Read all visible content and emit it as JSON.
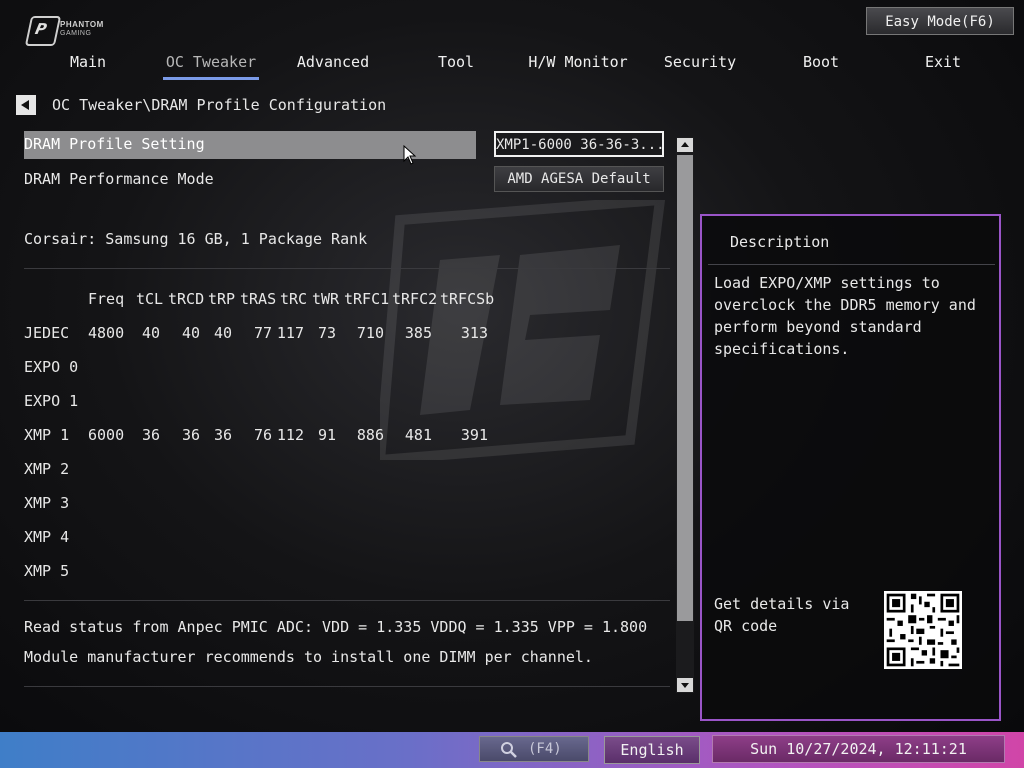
{
  "brand": {
    "logo_line1": "PHANTOM",
    "logo_line2": "GAMING"
  },
  "easy_mode_label": "Easy Mode(F6)",
  "tabs": [
    {
      "label": "Main"
    },
    {
      "label": "OC Tweaker",
      "active": true
    },
    {
      "label": "Advanced"
    },
    {
      "label": "Tool"
    },
    {
      "label": "H/W Monitor"
    },
    {
      "label": "Security"
    },
    {
      "label": "Boot"
    },
    {
      "label": "Exit"
    }
  ],
  "breadcrumb": "OC Tweaker\\DRAM Profile Configuration",
  "settings": {
    "dram_profile": {
      "label": "DRAM Profile Setting",
      "value": "XMP1-6000 36-36-3..."
    },
    "dram_perf_mode": {
      "label": "DRAM Performance Mode",
      "value": "AMD AGESA Default"
    }
  },
  "module_info": "Corsair: Samsung 16 GB, 1 Package Rank",
  "timing_table": {
    "headers": [
      "Freq",
      "tCL",
      "tRCD",
      "tRP",
      "tRAS",
      "tRC",
      "tWR",
      "tRFC1",
      "tRFC2",
      "tRFCSb"
    ],
    "rows": [
      {
        "name": "JEDEC",
        "values": [
          "4800",
          "40",
          "40",
          "40",
          "77",
          "117",
          "73",
          "710",
          "385",
          "313"
        ]
      },
      {
        "name": "EXPO 0",
        "values": []
      },
      {
        "name": "EXPO 1",
        "values": []
      },
      {
        "name": "XMP 1",
        "values": [
          "6000",
          "36",
          "36",
          "36",
          "76",
          "112",
          "91",
          "886",
          "481",
          "391"
        ]
      },
      {
        "name": "XMP 2",
        "values": []
      },
      {
        "name": "XMP 3",
        "values": []
      },
      {
        "name": "XMP 4",
        "values": []
      },
      {
        "name": "XMP 5",
        "values": []
      }
    ]
  },
  "status_line": "Read status from Anpec PMIC ADC: VDD = 1.335 VDDQ = 1.335 VPP = 1.800",
  "recommend_line": "Module manufacturer recommends to install one DIMM per channel.",
  "description": {
    "title": "Description",
    "body": "Load EXPO/XMP settings to overclock the DDR5 memory and perform beyond standard specifications.",
    "qr_text": "Get details via QR code"
  },
  "bottom": {
    "search_label": "(F4)",
    "language": "English",
    "datetime": "Sun 10/27/2024, 12:11:21"
  },
  "colors": {
    "accent_tab": "#7b9be8",
    "panel_border": "#9a55c8",
    "highlight": "#8d8d8f"
  }
}
